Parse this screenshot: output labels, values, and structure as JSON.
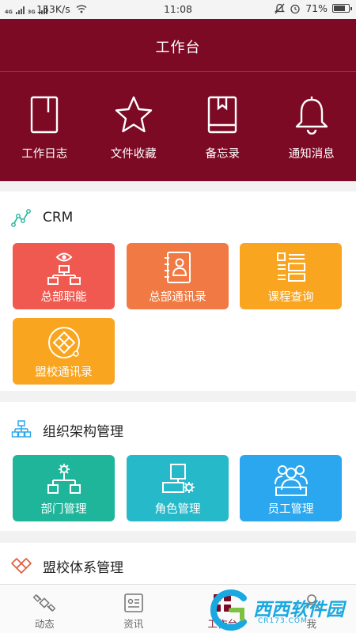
{
  "status_bar": {
    "network_1": "4G",
    "network_2": "3G",
    "speed": "153K/s",
    "time": "11:08",
    "battery": "71%"
  },
  "header": {
    "title": "工作台",
    "quick_actions": [
      {
        "label": "工作日志",
        "icon": "notebook-icon"
      },
      {
        "label": "文件收藏",
        "icon": "star-icon"
      },
      {
        "label": "备忘录",
        "icon": "book-icon"
      },
      {
        "label": "通知消息",
        "icon": "bell-icon"
      }
    ]
  },
  "sections": {
    "crm": {
      "title": "CRM",
      "tiles": [
        {
          "label": "总部职能",
          "color": "#f0594f",
          "icon": "org-eye-icon"
        },
        {
          "label": "总部通讯录",
          "color": "#f17a44",
          "icon": "contact-book-icon"
        },
        {
          "label": "课程查询",
          "color": "#f9a51f",
          "icon": "course-list-icon"
        },
        {
          "label": "盟校通讯录",
          "color": "#f9a51f",
          "icon": "alliance-icon"
        }
      ]
    },
    "org": {
      "title": "组织架构管理",
      "tiles": [
        {
          "label": "部门管理",
          "color": "#1fb59b",
          "icon": "department-icon"
        },
        {
          "label": "角色管理",
          "color": "#26b9c9",
          "icon": "role-settings-icon"
        },
        {
          "label": "员工管理",
          "color": "#2aa7ee",
          "icon": "staff-icon"
        }
      ]
    },
    "alliance": {
      "title": "盟校体系管理"
    }
  },
  "bottom_nav": [
    {
      "label": "动态",
      "icon": "satellite-icon"
    },
    {
      "label": "资讯",
      "icon": "news-icon"
    },
    {
      "label": "工作台",
      "icon": "workbench-icon"
    },
    {
      "label": "我",
      "icon": "person-icon"
    }
  ],
  "watermark": {
    "text": "西西软件园",
    "sub": "CR173.COM"
  },
  "colors": {
    "header_bg": "#7c0a24",
    "crm_icon": "#1fb59b",
    "org_icon": "#2aa7ee",
    "alliance_icon": "#e15b3b",
    "watermark": "#1aa8e0"
  }
}
